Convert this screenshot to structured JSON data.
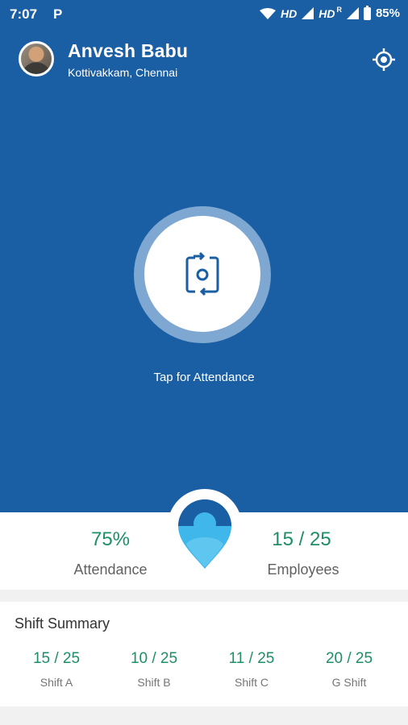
{
  "status_bar": {
    "time": "7:07",
    "app_indicator": "P",
    "network_1": "HD",
    "network_2": "HD",
    "roaming": "R",
    "battery": "85%"
  },
  "profile": {
    "name": "Anvesh Babu",
    "location": "Kottivakkam, Chennai"
  },
  "attendance_button": {
    "label": "Tap for Attendance",
    "icon": "rotate-camera-icon"
  },
  "stats": {
    "attendance_value": "75%",
    "attendance_label": "Attendance",
    "employees_value": "15 / 25",
    "employees_label": "Employees"
  },
  "shift_summary": {
    "title": "Shift Summary",
    "shifts": [
      {
        "value": "15 / 25",
        "label": "Shift A"
      },
      {
        "value": "10 / 25",
        "label": "Shift B"
      },
      {
        "value": "11 / 25",
        "label": "Shift C"
      },
      {
        "value": "20 / 25",
        "label": "G Shift"
      }
    ]
  },
  "colors": {
    "primary": "#1a5ea3",
    "accent_green": "#1e8e68",
    "ring": "#7ea8d1"
  }
}
